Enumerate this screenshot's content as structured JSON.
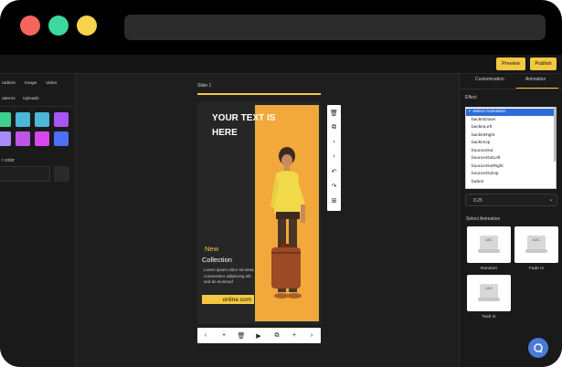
{
  "window": {
    "traffic_lights": {
      "red": "#f5655b",
      "green": "#3dd7a0",
      "yellow": "#f8d44c"
    }
  },
  "topbar": {
    "preview_label": "Preview",
    "publish_label": "Publish"
  },
  "left_panel": {
    "tabs": [
      "radient",
      "Image",
      "Video"
    ],
    "subtabs": [
      "atterns",
      "Uploads"
    ],
    "swatches": [
      "#3ecf8e",
      "#4ab7d8",
      "#4ab7d8",
      "#a855f7",
      "#a78bfa",
      "#c054e8",
      "#d946ef",
      "#4f6ef7"
    ],
    "color_label": "r color"
  },
  "canvas": {
    "slide_label": "Slide 1",
    "headline": "YOUR TEXT IS HERE",
    "new_label": "New",
    "collection_label": "Collection",
    "body_text": "Lorem ipsum dolor sit amet, consectetur adipiscing elit, sed do eiusmod",
    "url_text": "online.com",
    "side_tools": [
      "trash-icon",
      "copy-icon",
      "chevron-right-icon",
      "chevron-left-icon",
      "undo-icon",
      "redo-icon",
      "grid-icon"
    ],
    "bottom_tools": [
      "chevron-left-icon",
      "plus-icon",
      "trash-icon",
      "play-icon",
      "copy-icon",
      "plus-icon",
      "chevron-right-icon"
    ]
  },
  "right_panel": {
    "tabs": [
      "Customization",
      "Animation"
    ],
    "effect_label": "Effect",
    "animation_options": [
      "✓ Select Animation",
      "backInDown",
      "backInLeft",
      "backInRight",
      "backInUp",
      "bounceOut",
      "bounceOutLeft",
      "bounceOutRight",
      "bounceOutUp",
      "fadeIn"
    ],
    "duration_value": "0.25",
    "select_animation_label": "Select Animation",
    "cards": [
      "Random",
      "Fade In",
      "Twirl In"
    ],
    "card_abc": "ABC"
  },
  "colors": {
    "accent": "#f5c842",
    "selection": "#2f6bd8"
  }
}
